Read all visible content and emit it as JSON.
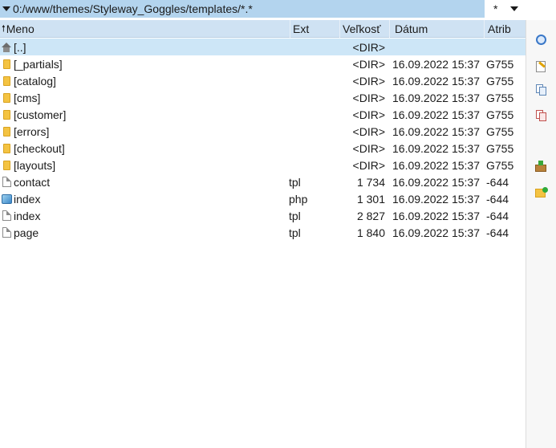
{
  "path": {
    "text": "0:/www/themes/Styleway_Goggles/templates/*.*",
    "filter": "*"
  },
  "columns": {
    "name": "Meno",
    "ext": "Ext",
    "size": "Veľkosť",
    "date": "Dátum",
    "attr": "Atrib"
  },
  "rows": [
    {
      "icon": "parent-dir-icon",
      "name": "[..]",
      "ext": "",
      "size": "<DIR>",
      "date": "",
      "attr": ""
    },
    {
      "icon": "folder-icon",
      "name": "[_partials]",
      "ext": "",
      "size": "<DIR>",
      "date": "16.09.2022 15:37",
      "attr": "G755"
    },
    {
      "icon": "folder-icon",
      "name": "[catalog]",
      "ext": "",
      "size": "<DIR>",
      "date": "16.09.2022 15:37",
      "attr": "G755"
    },
    {
      "icon": "folder-icon",
      "name": "[cms]",
      "ext": "",
      "size": "<DIR>",
      "date": "16.09.2022 15:37",
      "attr": "G755"
    },
    {
      "icon": "folder-icon",
      "name": "[customer]",
      "ext": "",
      "size": "<DIR>",
      "date": "16.09.2022 15:37",
      "attr": "G755"
    },
    {
      "icon": "folder-icon",
      "name": "[errors]",
      "ext": "",
      "size": "<DIR>",
      "date": "16.09.2022 15:37",
      "attr": "G755"
    },
    {
      "icon": "folder-icon",
      "name": "[checkout]",
      "ext": "",
      "size": "<DIR>",
      "date": "16.09.2022 15:37",
      "attr": "G755"
    },
    {
      "icon": "folder-icon",
      "name": "[layouts]",
      "ext": "",
      "size": "<DIR>",
      "date": "16.09.2022 15:37",
      "attr": "G755"
    },
    {
      "icon": "file-icon",
      "name": "contact",
      "ext": "tpl",
      "size": "1 734",
      "date": "16.09.2022 15:37",
      "attr": "-644"
    },
    {
      "icon": "php-file-icon",
      "name": "index",
      "ext": "php",
      "size": "1 301",
      "date": "16.09.2022 15:37",
      "attr": "-644"
    },
    {
      "icon": "file-icon",
      "name": "index",
      "ext": "tpl",
      "size": "2 827",
      "date": "16.09.2022 15:37",
      "attr": "-644"
    },
    {
      "icon": "file-icon",
      "name": "page",
      "ext": "tpl",
      "size": "1 840",
      "date": "16.09.2022 15:37",
      "attr": "-644"
    }
  ],
  "toolbar": [
    {
      "icon": "view-icon"
    },
    {
      "icon": "edit-icon"
    },
    {
      "icon": "copy-icon"
    },
    {
      "icon": "move-icon"
    },
    {
      "icon": "pack-icon"
    },
    {
      "icon": "new-folder-icon"
    }
  ],
  "colors": {
    "path_bar": "#b3d4ee",
    "header": "#cfe2f3",
    "selected_row": "#cde6f7",
    "folder": "#f4c342"
  }
}
